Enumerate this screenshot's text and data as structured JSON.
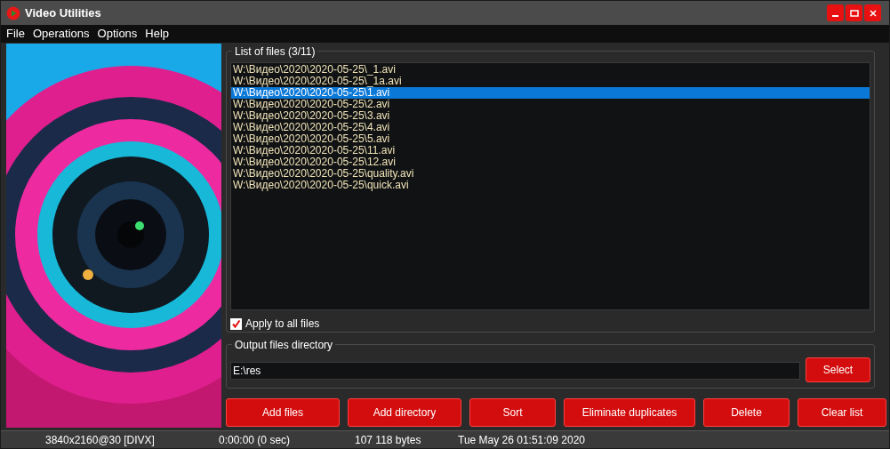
{
  "window": {
    "title": "Video Utilities"
  },
  "menu": [
    "File",
    "Operations",
    "Options",
    "Help"
  ],
  "file_list": {
    "title": "List of files (3/11)",
    "items": [
      {
        "path": "W:\\Видео\\2020\\2020-05-25\\_1.avi",
        "selected": false
      },
      {
        "path": "W:\\Видео\\2020\\2020-05-25\\_1a.avi",
        "selected": false
      },
      {
        "path": "W:\\Видео\\2020\\2020-05-25\\1.avi",
        "selected": true
      },
      {
        "path": "W:\\Видео\\2020\\2020-05-25\\2.avi",
        "selected": false
      },
      {
        "path": "W:\\Видео\\2020\\2020-05-25\\3.avi",
        "selected": false
      },
      {
        "path": "W:\\Видео\\2020\\2020-05-25\\4.avi",
        "selected": false
      },
      {
        "path": "W:\\Видео\\2020\\2020-05-25\\5.avi",
        "selected": false
      },
      {
        "path": "W:\\Видео\\2020\\2020-05-25\\11.avi",
        "selected": false
      },
      {
        "path": "W:\\Видео\\2020\\2020-05-25\\12.avi",
        "selected": false
      },
      {
        "path": "W:\\Видео\\2020\\2020-05-25\\quality.avi",
        "selected": false
      },
      {
        "path": "W:\\Видео\\2020\\2020-05-25\\quick.avi",
        "selected": false
      }
    ]
  },
  "apply_to_all": {
    "label": "Apply to all files",
    "checked": true
  },
  "output": {
    "title": "Output files directory",
    "value": "E:\\res",
    "button": "Select"
  },
  "buttons": [
    "Add files",
    "Add directory",
    "Sort",
    "Eliminate duplicates",
    "Delete",
    "Clear list"
  ],
  "status_bar": [
    "3840x2160@30 [DIVX]",
    "0:00:00 (0 sec)",
    "107 118 bytes",
    "Tue May 26 01:51:09 2020"
  ]
}
